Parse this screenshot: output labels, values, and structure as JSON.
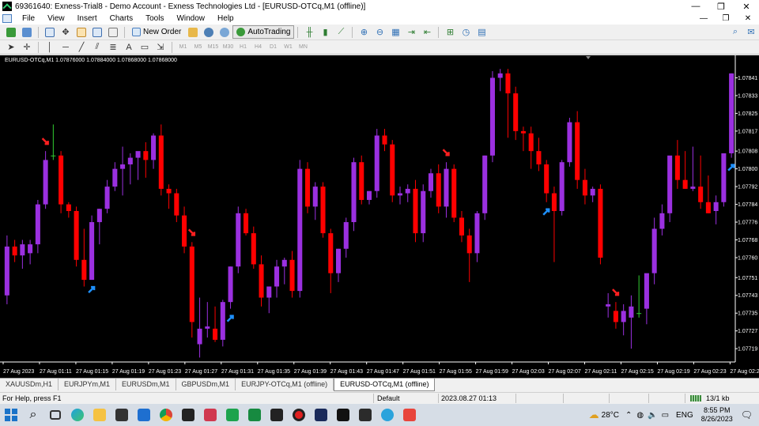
{
  "window": {
    "title": "69361640: Exness-Trial8 - Demo Account - Exness Technologies Ltd - [EURUSD-OTCq,M1 (offline)]",
    "controls": [
      "—",
      "❐",
      "✕"
    ]
  },
  "menu": {
    "items": [
      "File",
      "View",
      "Insert",
      "Charts",
      "Tools",
      "Window",
      "Help"
    ],
    "mdi_controls": [
      "—",
      "❐",
      "✕"
    ]
  },
  "toolbar": {
    "new_order_label": "New Order",
    "autotrading_label": "AutoTrading",
    "timeframes": [
      "M1",
      "M5",
      "M15",
      "M30",
      "H1",
      "H4",
      "D1",
      "W1",
      "MN"
    ],
    "text_tool": "A"
  },
  "chart": {
    "header": "EURUSD-OTCq,M1  1.07876000 1.07884000 1.07868000 1.07868000",
    "background": "#000000",
    "bull_color": "#9b30e0",
    "bear_color": "#ff0000",
    "doji_color": "#32cd32",
    "buy_arrow_color": "#1e90ff",
    "sell_arrow_color": "#ff2020"
  },
  "chart_data": {
    "type": "candlestick",
    "symbol": "EURUSD-OTCq",
    "timeframe": "M1",
    "y_ticks": [
      "1.07841",
      "1.07833",
      "1.07825",
      "1.07817",
      "1.07808",
      "1.07800",
      "1.07792",
      "1.07784",
      "1.07776",
      "1.07768",
      "1.07760",
      "1.07751",
      "1.07743",
      "1.07735",
      "1.07727",
      "1.07719"
    ],
    "ylim": [
      1.07713,
      1.07849
    ],
    "x_ticks": [
      "27 Aug 2023",
      "27 Aug 01:11",
      "27 Aug 01:15",
      "27 Aug 01:19",
      "27 Aug 01:23",
      "27 Aug 01:27",
      "27 Aug 01:31",
      "27 Aug 01:35",
      "27 Aug 01:39",
      "27 Aug 01:43",
      "27 Aug 01:47",
      "27 Aug 01:51",
      "27 Aug 01:55",
      "27 Aug 01:59",
      "27 Aug 02:03",
      "27 Aug 02:07",
      "27 Aug 02:11",
      "27 Aug 02:15",
      "27 Aug 02:19",
      "27 Aug 02:23",
      "27 Aug 02:27"
    ],
    "candles": [
      {
        "o": 1.07743,
        "h": 1.0777,
        "l": 1.07739,
        "c": 1.07765
      },
      {
        "o": 1.07765,
        "h": 1.07768,
        "l": 1.07758,
        "c": 1.07761
      },
      {
        "o": 1.07761,
        "h": 1.07768,
        "l": 1.07755,
        "c": 1.07766
      },
      {
        "o": 1.07762,
        "h": 1.07768,
        "l": 1.07757,
        "c": 1.07766
      },
      {
        "o": 1.07766,
        "h": 1.07786,
        "l": 1.07762,
        "c": 1.07784
      },
      {
        "o": 1.07784,
        "h": 1.07808,
        "l": 1.07782,
        "c": 1.07804
      },
      {
        "o": 1.07806,
        "h": 1.0782,
        "l": 1.07804,
        "c": 1.07806
      },
      {
        "o": 1.07806,
        "h": 1.07808,
        "l": 1.0778,
        "c": 1.07784
      },
      {
        "o": 1.07784,
        "h": 1.07785,
        "l": 1.07778,
        "c": 1.07781
      },
      {
        "o": 1.07781,
        "h": 1.07783,
        "l": 1.07756,
        "c": 1.07759
      },
      {
        "o": 1.07759,
        "h": 1.07773,
        "l": 1.07747,
        "c": 1.0775
      },
      {
        "o": 1.0775,
        "h": 1.07779,
        "l": 1.0775,
        "c": 1.07776
      },
      {
        "o": 1.07776,
        "h": 1.07782,
        "l": 1.07766,
        "c": 1.07782
      },
      {
        "o": 1.07782,
        "h": 1.07795,
        "l": 1.0778,
        "c": 1.07792
      },
      {
        "o": 1.07792,
        "h": 1.07803,
        "l": 1.0779,
        "c": 1.078
      },
      {
        "o": 1.078,
        "h": 1.0781,
        "l": 1.07788,
        "c": 1.07802
      },
      {
        "o": 1.07802,
        "h": 1.07807,
        "l": 1.07793,
        "c": 1.07805
      },
      {
        "o": 1.07805,
        "h": 1.07807,
        "l": 1.07795,
        "c": 1.07808
      },
      {
        "o": 1.07808,
        "h": 1.07812,
        "l": 1.07796,
        "c": 1.07804
      },
      {
        "o": 1.07804,
        "h": 1.07816,
        "l": 1.078,
        "c": 1.07815
      },
      {
        "o": 1.07815,
        "h": 1.0782,
        "l": 1.07788,
        "c": 1.07791
      },
      {
        "o": 1.07791,
        "h": 1.07793,
        "l": 1.07782,
        "c": 1.07789
      },
      {
        "o": 1.07789,
        "h": 1.07791,
        "l": 1.07776,
        "c": 1.07779
      },
      {
        "o": 1.07779,
        "h": 1.07783,
        "l": 1.07762,
        "c": 1.07765
      },
      {
        "o": 1.07765,
        "h": 1.07767,
        "l": 1.07724,
        "c": 1.07731
      },
      {
        "o": 1.07721,
        "h": 1.07742,
        "l": 1.07715,
        "c": 1.07728
      },
      {
        "o": 1.07728,
        "h": 1.0774,
        "l": 1.07724,
        "c": 1.07729
      },
      {
        "o": 1.07728,
        "h": 1.07738,
        "l": 1.07722,
        "c": 1.07723
      },
      {
        "o": 1.07723,
        "h": 1.07741,
        "l": 1.0772,
        "c": 1.0774
      },
      {
        "o": 1.0774,
        "h": 1.07756,
        "l": 1.07737,
        "c": 1.07756
      },
      {
        "o": 1.07756,
        "h": 1.07783,
        "l": 1.07753,
        "c": 1.0778
      },
      {
        "o": 1.0778,
        "h": 1.07782,
        "l": 1.0777,
        "c": 1.07771
      },
      {
        "o": 1.07771,
        "h": 1.07774,
        "l": 1.07755,
        "c": 1.07757
      },
      {
        "o": 1.07757,
        "h": 1.07761,
        "l": 1.07738,
        "c": 1.07742
      },
      {
        "o": 1.07742,
        "h": 1.07746,
        "l": 1.07735,
        "c": 1.07747
      },
      {
        "o": 1.07747,
        "h": 1.07759,
        "l": 1.07742,
        "c": 1.07756
      },
      {
        "o": 1.07756,
        "h": 1.0776,
        "l": 1.07748,
        "c": 1.07759
      },
      {
        "o": 1.07759,
        "h": 1.07763,
        "l": 1.07742,
        "c": 1.07745
      },
      {
        "o": 1.07745,
        "h": 1.07804,
        "l": 1.07742,
        "c": 1.078
      },
      {
        "o": 1.078,
        "h": 1.07803,
        "l": 1.0778,
        "c": 1.07783
      },
      {
        "o": 1.07783,
        "h": 1.07794,
        "l": 1.07777,
        "c": 1.07792
      },
      {
        "o": 1.07792,
        "h": 1.07794,
        "l": 1.07769,
        "c": 1.07771
      },
      {
        "o": 1.07771,
        "h": 1.07773,
        "l": 1.07744,
        "c": 1.07753
      },
      {
        "o": 1.07753,
        "h": 1.07764,
        "l": 1.07749,
        "c": 1.07764
      },
      {
        "o": 1.07764,
        "h": 1.07778,
        "l": 1.0776,
        "c": 1.07776
      },
      {
        "o": 1.07776,
        "h": 1.07805,
        "l": 1.07772,
        "c": 1.07803
      },
      {
        "o": 1.07803,
        "h": 1.07806,
        "l": 1.07784,
        "c": 1.07786
      },
      {
        "o": 1.07786,
        "h": 1.0779,
        "l": 1.07784,
        "c": 1.0779
      },
      {
        "o": 1.0779,
        "h": 1.07818,
        "l": 1.07787,
        "c": 1.07815
      },
      {
        "o": 1.07815,
        "h": 1.07818,
        "l": 1.07808,
        "c": 1.07811
      },
      {
        "o": 1.07811,
        "h": 1.07813,
        "l": 1.07785,
        "c": 1.07788
      },
      {
        "o": 1.07788,
        "h": 1.07792,
        "l": 1.07784,
        "c": 1.07789
      },
      {
        "o": 1.07789,
        "h": 1.07793,
        "l": 1.07785,
        "c": 1.07791
      },
      {
        "o": 1.07791,
        "h": 1.07795,
        "l": 1.07767,
        "c": 1.07771
      },
      {
        "o": 1.07771,
        "h": 1.07793,
        "l": 1.07767,
        "c": 1.0779
      },
      {
        "o": 1.0779,
        "h": 1.078,
        "l": 1.07787,
        "c": 1.07798
      },
      {
        "o": 1.07798,
        "h": 1.07802,
        "l": 1.0778,
        "c": 1.07783
      },
      {
        "o": 1.07783,
        "h": 1.07803,
        "l": 1.07778,
        "c": 1.078
      },
      {
        "o": 1.078,
        "h": 1.07802,
        "l": 1.07776,
        "c": 1.07778
      },
      {
        "o": 1.07778,
        "h": 1.07781,
        "l": 1.07767,
        "c": 1.0777
      },
      {
        "o": 1.0777,
        "h": 1.07773,
        "l": 1.07749,
        "c": 1.07762
      },
      {
        "o": 1.07762,
        "h": 1.07781,
        "l": 1.07758,
        "c": 1.0778
      },
      {
        "o": 1.0778,
        "h": 1.07806,
        "l": 1.07777,
        "c": 1.07806
      },
      {
        "o": 1.07806,
        "h": 1.07844,
        "l": 1.07803,
        "c": 1.07841
      },
      {
        "o": 1.07841,
        "h": 1.07845,
        "l": 1.07835,
        "c": 1.07843
      },
      {
        "o": 1.07843,
        "h": 1.07845,
        "l": 1.07814,
        "c": 1.07834
      },
      {
        "o": 1.07834,
        "h": 1.07837,
        "l": 1.07813,
        "c": 1.07817
      },
      {
        "o": 1.07817,
        "h": 1.07819,
        "l": 1.07808,
        "c": 1.07816
      },
      {
        "o": 1.07816,
        "h": 1.07819,
        "l": 1.078,
        "c": 1.07808
      },
      {
        "o": 1.07808,
        "h": 1.07814,
        "l": 1.07799,
        "c": 1.07802
      },
      {
        "o": 1.07802,
        "h": 1.07804,
        "l": 1.07785,
        "c": 1.07789
      },
      {
        "o": 1.07789,
        "h": 1.07792,
        "l": 1.07758,
        "c": 1.07781
      },
      {
        "o": 1.07781,
        "h": 1.07804,
        "l": 1.07779,
        "c": 1.07803
      },
      {
        "o": 1.07803,
        "h": 1.07823,
        "l": 1.07801,
        "c": 1.07821
      },
      {
        "o": 1.07821,
        "h": 1.07826,
        "l": 1.07791,
        "c": 1.07795
      },
      {
        "o": 1.07795,
        "h": 1.078,
        "l": 1.07784,
        "c": 1.07788
      },
      {
        "o": 1.07788,
        "h": 1.07792,
        "l": 1.07785,
        "c": 1.07791
      },
      {
        "o": 1.07791,
        "h": 1.07793,
        "l": 1.07757,
        "c": 1.0776
      },
      {
        "o": 1.07738,
        "h": 1.07744,
        "l": 1.07733,
        "c": 1.07739
      },
      {
        "o": 1.07736,
        "h": 1.0774,
        "l": 1.07728,
        "c": 1.07731
      },
      {
        "o": 1.07731,
        "h": 1.07739,
        "l": 1.07725,
        "c": 1.07736
      },
      {
        "o": 1.07733,
        "h": 1.07743,
        "l": 1.07719,
        "c": 1.07738
      },
      {
        "o": 1.07735,
        "h": 1.07752,
        "l": 1.07733,
        "c": 1.07735
      },
      {
        "o": 1.07737,
        "h": 1.07752,
        "l": 1.0773,
        "c": 1.07753
      },
      {
        "o": 1.07753,
        "h": 1.07778,
        "l": 1.07748,
        "c": 1.07773
      },
      {
        "o": 1.07773,
        "h": 1.07784,
        "l": 1.0777,
        "c": 1.0778
      },
      {
        "o": 1.0778,
        "h": 1.07804,
        "l": 1.07776,
        "c": 1.07806
      },
      {
        "o": 1.07806,
        "h": 1.07813,
        "l": 1.07791,
        "c": 1.07795
      },
      {
        "o": 1.07795,
        "h": 1.07808,
        "l": 1.07791,
        "c": 1.07791
      },
      {
        "o": 1.07791,
        "h": 1.0781,
        "l": 1.0779,
        "c": 1.07792
      },
      {
        "o": 1.07792,
        "h": 1.07806,
        "l": 1.07782,
        "c": 1.07785
      },
      {
        "o": 1.07785,
        "h": 1.07797,
        "l": 1.0778,
        "c": 1.0778
      },
      {
        "o": 1.07781,
        "h": 1.07788,
        "l": 1.07775,
        "c": 1.07785
      },
      {
        "o": 1.07785,
        "h": 1.07807,
        "l": 1.07783,
        "c": 1.07807
      },
      {
        "o": 1.07807,
        "h": 1.07843,
        "l": 1.07805,
        "c": 1.07843
      }
    ],
    "buy_signals": [
      11,
      29,
      70,
      94,
      140
    ],
    "sell_signals": [
      5,
      24,
      57,
      79,
      104
    ],
    "grid": false
  },
  "tabs": [
    "XAUUSDm,H1",
    "EURJPYm,M1",
    "EURUSDm,M1",
    "GBPUSDm,M1",
    "EURJPY-OTCq,M1 (offline)",
    "EURUSD-OTCq,M1 (offline)"
  ],
  "active_tab": 5,
  "status": {
    "help": "For Help, press F1",
    "profile": "Default",
    "datetime": "2023.08.27 01:13",
    "traffic": "13/1 kb"
  },
  "taskbar": {
    "weather": "28°C",
    "language": "ENG",
    "time": "8:55 PM",
    "date": "8/26/2023"
  }
}
